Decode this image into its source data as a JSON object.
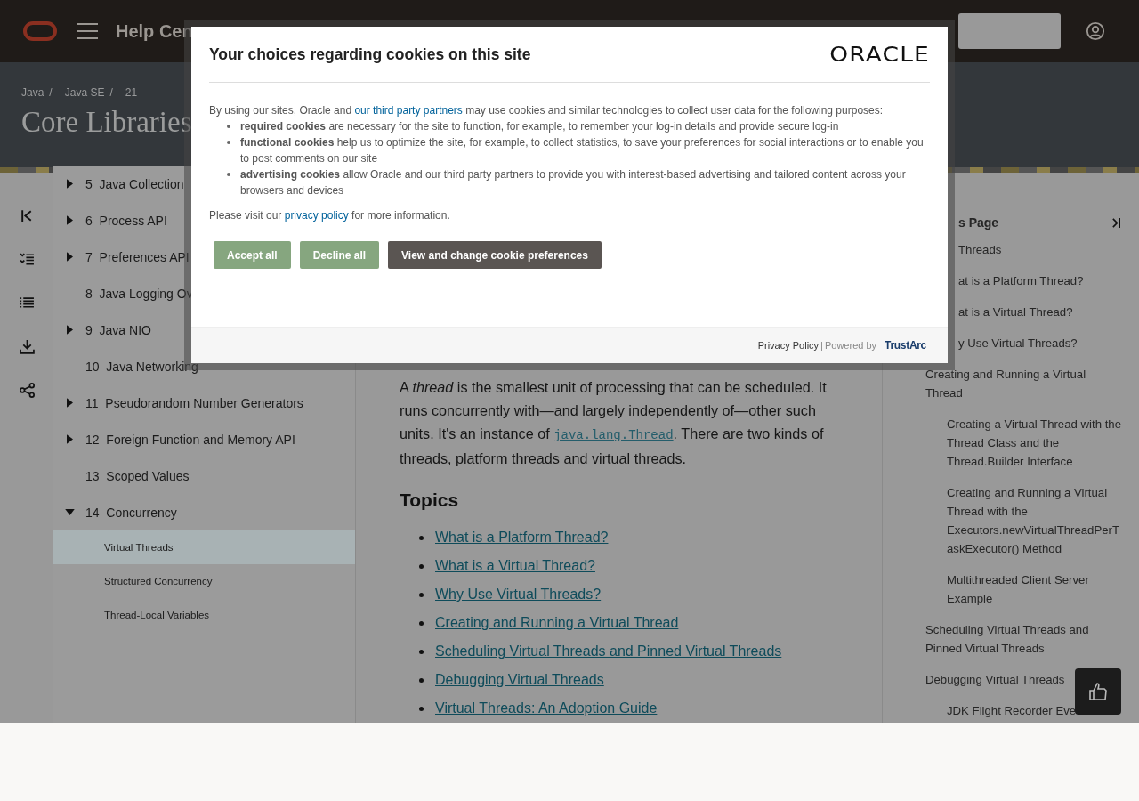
{
  "header": {
    "site_title": "Help Cen"
  },
  "banner": {
    "breadcrumb": [
      "Java",
      "Java SE",
      "21"
    ],
    "breadcrumb_separator": "/",
    "title": "Core Libraries"
  },
  "tree": {
    "items": [
      {
        "number": "5",
        "label": "Java Collection",
        "expandable": true,
        "expanded": false
      },
      {
        "number": "6",
        "label": "Process API",
        "expandable": true,
        "expanded": false
      },
      {
        "number": "7",
        "label": "Preferences API",
        "expandable": true,
        "expanded": false
      },
      {
        "number": "8",
        "label": "Java Logging Ov",
        "expandable": false
      },
      {
        "number": "9",
        "label": "Java NIO",
        "expandable": true,
        "expanded": false
      },
      {
        "number": "10",
        "label": "Java Networking",
        "expandable": false
      },
      {
        "number": "11",
        "label": "Pseudorandom Number Generators",
        "expandable": true,
        "expanded": false
      },
      {
        "number": "12",
        "label": "Foreign Function and Memory API",
        "expandable": true,
        "expanded": false
      },
      {
        "number": "13",
        "label": "Scoped Values",
        "expandable": false
      },
      {
        "number": "14",
        "label": "Concurrency",
        "expandable": true,
        "expanded": true,
        "children": [
          {
            "label": "Virtual Threads",
            "selected": true
          },
          {
            "label": "Structured Concurrency",
            "selected": false
          },
          {
            "label": "Thread-Local Variables",
            "selected": false
          }
        ]
      }
    ]
  },
  "article": {
    "intro_before": "A *thread* is the smallest unit of processing that can be scheduled. It runs concurrently with—and largely independently of—other such units. It's an instance of ",
    "intro_code_link": "java.lang.Thread",
    "intro_after": ". There are two kinds of threads, platform threads and virtual threads.",
    "topics_heading": "Topics",
    "topics": [
      "What is a Platform Thread?",
      "What is a Virtual Thread?",
      "Why Use Virtual Threads?",
      "Creating and Running a Virtual Thread",
      "Scheduling Virtual Threads and Pinned Virtual Threads",
      "Debugging Virtual Threads",
      "Virtual Threads: An Adoption Guide"
    ]
  },
  "toc": {
    "heading": "s Page",
    "top_items": [
      "Threads",
      "at is a Platform Thread?",
      "at is a Virtual Thread?",
      "y Use Virtual Threads?"
    ],
    "items": [
      {
        "label": "Creating and Running a Virtual Thread",
        "children": [
          "Creating a Virtual Thread with the Thread Class and the Thread.Builder Interface",
          "Creating and Running a Virtual Thread with the Executors.newVirtualThreadPerTaskExecutor() Method",
          "Multithreaded Client Server Example"
        ]
      },
      {
        "label": "Scheduling Virtual Threads and Pinned Virtual Threads"
      },
      {
        "label": "Debugging Virtual Threads",
        "children": [
          "JDK Flight Recorder Eve"
        ]
      }
    ]
  },
  "cookie_dialog": {
    "title": "Your choices regarding cookies on this site",
    "logo": "ORACLE",
    "intro_before": "By using our sites, Oracle and ",
    "intro_link": "our third party partners",
    "intro_after": " may use cookies and similar technologies to collect user data for the following purposes:",
    "purposes": [
      "**required cookies** are necessary for the site to function, for example, to remember your log-in details and provide secure log-in",
      "**functional cookies** help us to optimize the site, for example, to collect statistics, to save your preferences for social interactions or to enable you to post comments on our site",
      "**advertising cookies** allow Oracle and our third party partners to provide you with interest-based advertising and tailored content across your browsers and devices"
    ],
    "visit_before": "Please visit our ",
    "visit_link": "privacy policy",
    "visit_after": " for more information.",
    "buttons": [
      {
        "label": "Accept all",
        "kind": "accept"
      },
      {
        "label": "Decline all",
        "kind": "decline"
      },
      {
        "label": "View and change cookie preferences",
        "kind": "preferences"
      }
    ],
    "footer_link": "Privacy Policy",
    "footer_separator": "|",
    "footer_powered": "Powered by",
    "footer_brand": "TrustArc"
  }
}
